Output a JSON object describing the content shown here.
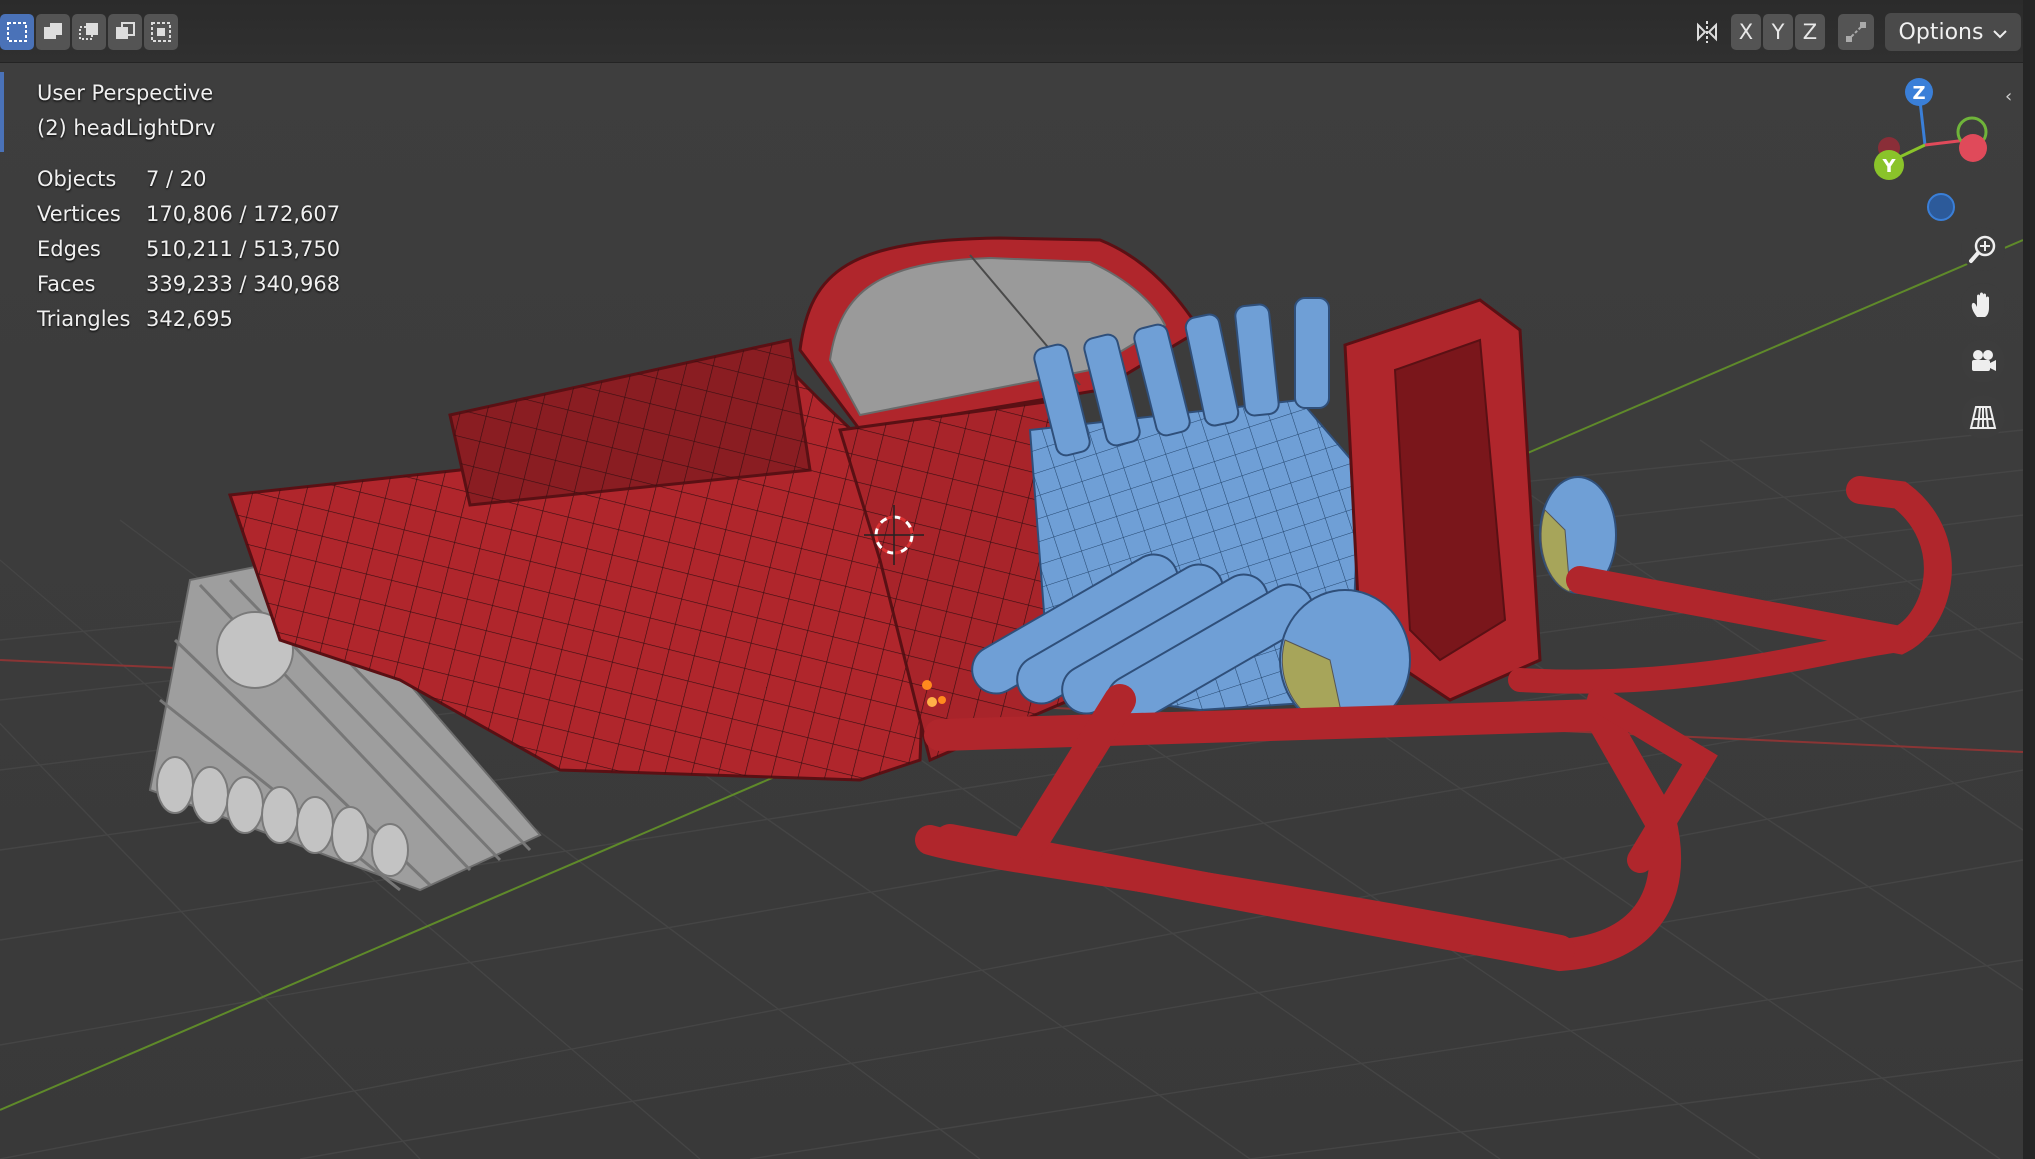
{
  "header": {
    "select_modes": [
      "select-box-icon",
      "extend-selection-icon",
      "subtract-selection-icon",
      "invert-selection-icon",
      "intersect-selection-icon"
    ],
    "axis_x": "X",
    "axis_y": "Y",
    "axis_z": "Z",
    "options_label": "Options"
  },
  "overlay": {
    "view_name": "User Perspective",
    "object_name": "(2) headLightDrv"
  },
  "stats": [
    {
      "label": "Objects",
      "value": "7 / 20"
    },
    {
      "label": "Vertices",
      "value": "170,806 / 172,607"
    },
    {
      "label": "Edges",
      "value": "510,211 / 513,750"
    },
    {
      "label": "Faces",
      "value": "339,233 / 340,968"
    },
    {
      "label": "Triangles",
      "value": "342,695"
    }
  ],
  "gizmo": {
    "z_label": "Z",
    "y_label": "Y",
    "colors": {
      "x": "#e04a5a",
      "y": "#8ac32a",
      "z": "#3a7fd8",
      "grid_x": "#9a3a3a",
      "grid_y": "#5c8a2c"
    }
  },
  "scene_colors": {
    "body": "#b0262c",
    "engine": "#6f9fd6",
    "track": "#a8a8a8",
    "lamp": "#a7a55a",
    "glass": "#9a9a9a"
  }
}
